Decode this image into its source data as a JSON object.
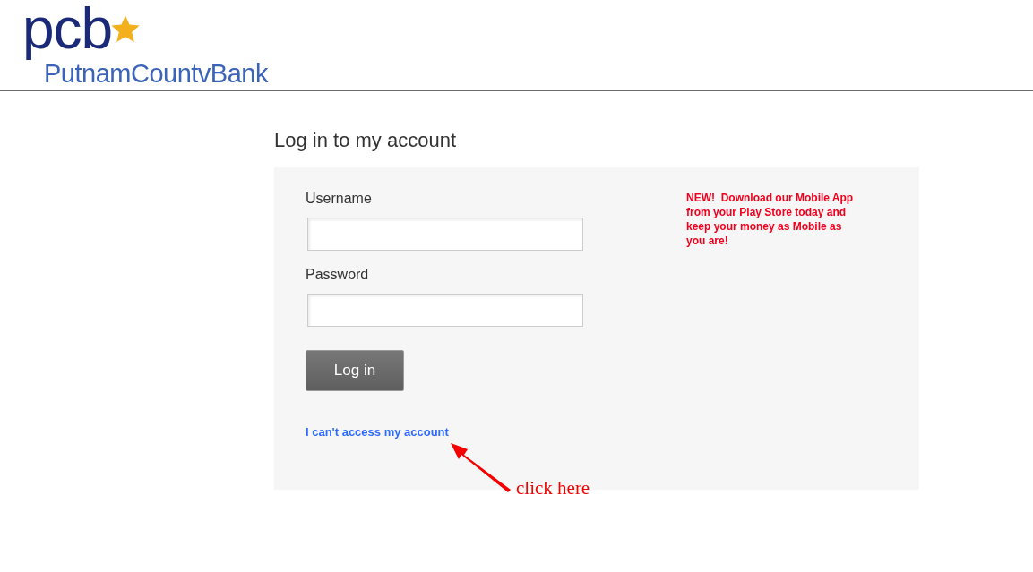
{
  "logo": {
    "mark": "pcb",
    "name": "PutnamCountvBank"
  },
  "title": "Log in to my account",
  "form": {
    "fields": [
      {
        "label": "Username"
      },
      {
        "label": "Password"
      }
    ],
    "button": "Log in",
    "link": "I can't access my account"
  },
  "promo": "NEW!  Download our Mobile App from your Play Store today and keep your money as Mobile as you are!",
  "annotation": "click here"
}
